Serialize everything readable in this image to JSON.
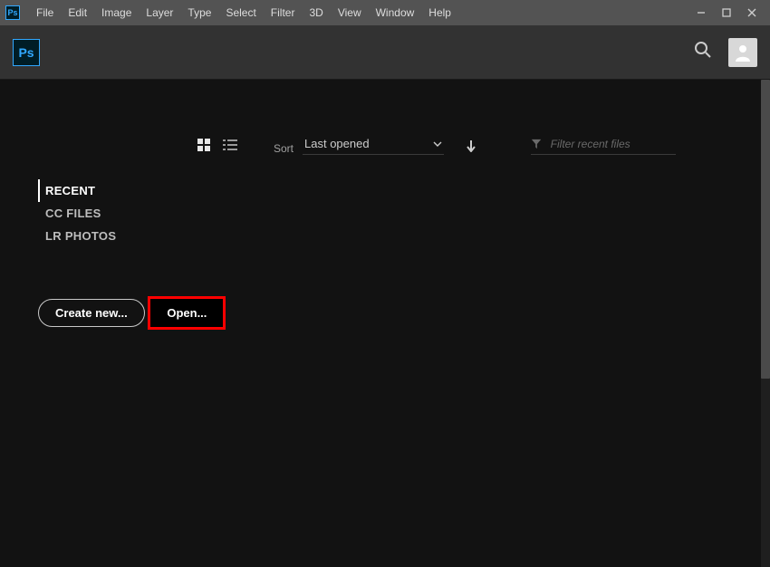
{
  "menu": {
    "items": [
      "File",
      "Edit",
      "Image",
      "Layer",
      "Type",
      "Select",
      "Filter",
      "3D",
      "View",
      "Window",
      "Help"
    ]
  },
  "app": {
    "short": "Ps"
  },
  "sidebar": {
    "items": [
      {
        "label": "RECENT",
        "active": true
      },
      {
        "label": "CC FILES",
        "active": false
      },
      {
        "label": "LR PHOTOS",
        "active": false
      }
    ],
    "create_label": "Create new...",
    "open_label": "Open..."
  },
  "toolbar": {
    "sort_label": "Sort",
    "sort_value": "Last opened",
    "filter_placeholder": "Filter recent files"
  }
}
